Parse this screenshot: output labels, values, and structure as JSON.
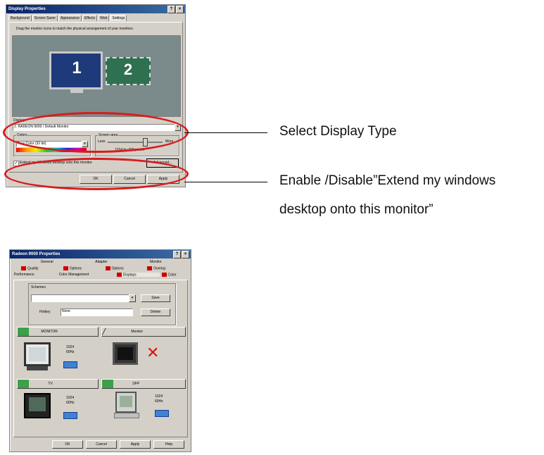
{
  "display_properties": {
    "title": "Display Properties",
    "tabs": [
      "Background",
      "Screen Saver",
      "Appearance",
      "Effects",
      "Web",
      "Settings"
    ],
    "active_tab": "Settings",
    "instruction": "Drag the monitor icons to match the physical arrangement of your monitors.",
    "monitor_1": "1",
    "monitor_2": "2",
    "display_label": "Display:",
    "display_value": "2. RADEON 9000 / Default Monitor",
    "colors_label": "Colors",
    "colors_value": "True Color (32 bit)",
    "screen_area_label": "Screen area",
    "screen_area_less": "Less",
    "screen_area_more": "More",
    "screen_area_value": "1024 by 768 pixels",
    "extend_checkbox": "Extend my Windows desktop onto this monitor.",
    "advanced_button": "Advanced...",
    "ok_button": "OK",
    "cancel_button": "Cancel",
    "apply_button": "Apply"
  },
  "radeon_properties": {
    "title": "Radeon 9000 Properties",
    "tabs_row1": [
      "General",
      "Adapter",
      "Monitor"
    ],
    "tabs_row2": [
      "Quality",
      "Options",
      "Options",
      "Overlay"
    ],
    "tabs_row3": [
      "Performance",
      "Color Management",
      "Displays",
      "Color"
    ],
    "scheme_label": "Schemes",
    "save_button": "Save",
    "hotkey_label": "Hotkey",
    "hotkey_value": "None",
    "delete_button": "Delete",
    "monitor_panel": "MONITOR",
    "monitor_res": "1024\n60Hz",
    "lcd_panel": "Monitor",
    "tv_panel": "TV",
    "tv_res": "1024\n60Hz",
    "dfp_panel": "DFP",
    "dfp_res": "1024\n60Hz",
    "ok_button": "OK",
    "cancel_button": "Cancel",
    "apply_button": "Apply",
    "help_button": "Help"
  },
  "callouts": {
    "select_display_type": "Select Display Type",
    "extend_line1": "Enable /Disable”Extend my windows",
    "extend_line2": "desktop onto this monitor”"
  },
  "colors": {
    "highlight": "#d81c1c",
    "monitor1": "#1e3a7a",
    "monitor2": "#2f7050"
  }
}
